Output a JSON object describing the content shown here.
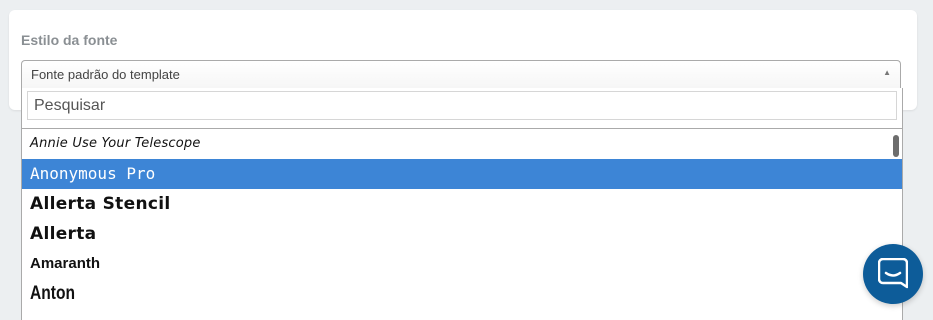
{
  "font_style": {
    "label": "Estilo da fonte",
    "selected_value": "Fonte padrão do template",
    "search": {
      "placeholder": "Pesquisar",
      "value": ""
    },
    "options": [
      {
        "label": "Annie Use Your Telescope",
        "highlighted": false
      },
      {
        "label": "Anonymous Pro",
        "highlighted": true
      },
      {
        "label": "Allerta Stencil",
        "highlighted": false
      },
      {
        "label": "Allerta",
        "highlighted": false
      },
      {
        "label": "Amaranth",
        "highlighted": false
      },
      {
        "label": "Anton",
        "highlighted": false
      }
    ]
  },
  "chat_widget": {
    "icon": "chat-bubble-icon"
  },
  "colors": {
    "highlight": "#3d85d6",
    "chat_button": "#0d5c99"
  }
}
